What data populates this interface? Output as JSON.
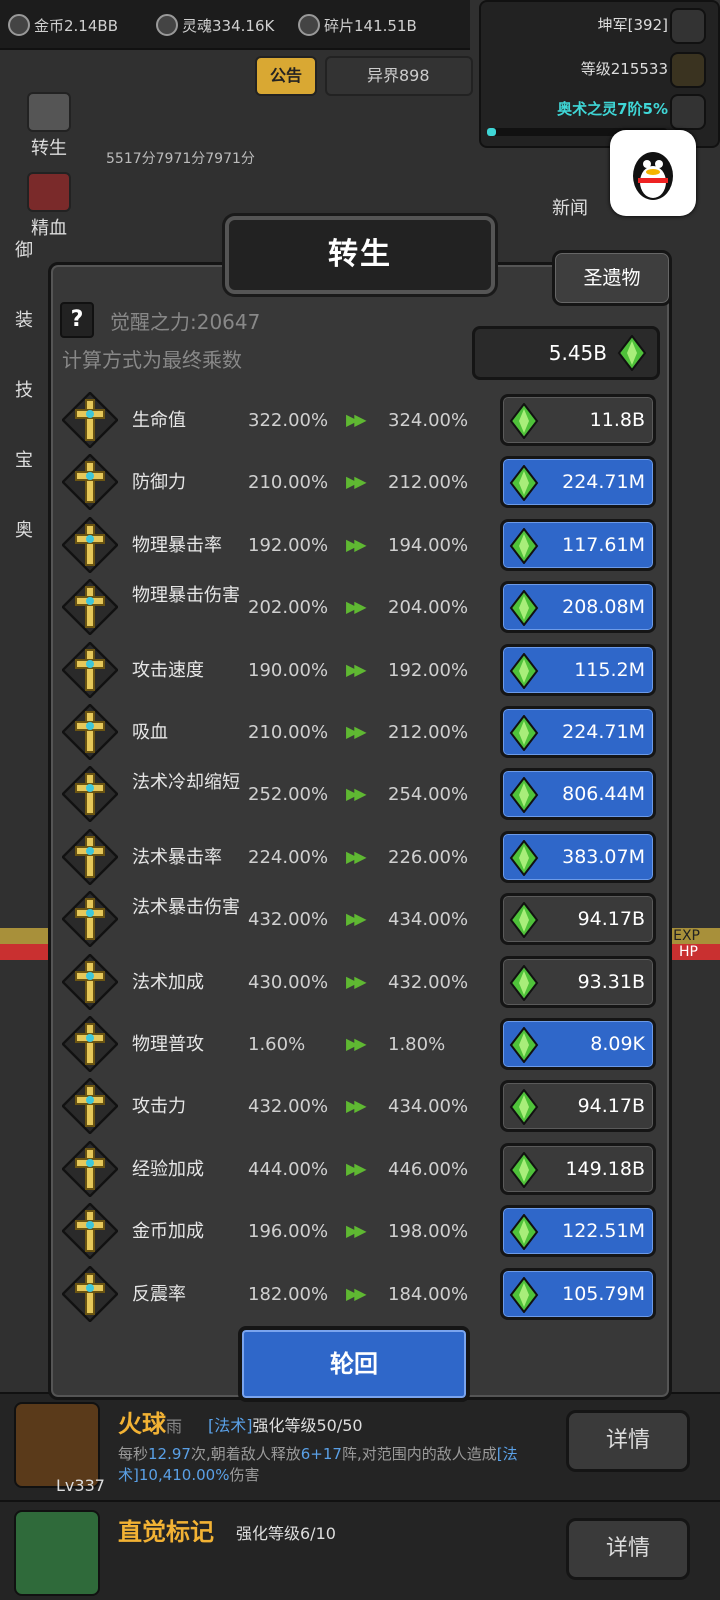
{
  "topbar": {
    "gold": "金币2.14BB",
    "soul": "灵魂334.16K",
    "shard": "碎片141.51B"
  },
  "right_panel": {
    "rank": "坤军[392]",
    "level": "等级215533",
    "arcane": "奥术之灵7阶5%",
    "arcane_progress": 0.05
  },
  "top_buttons": {
    "notice": "公告",
    "otherworld": "异界898"
  },
  "side_menu": [
    "转生",
    "精血",
    "御",
    "装",
    "技",
    "宝",
    "奥"
  ],
  "new_news": "新闻",
  "damage_text": "5517分7971分7971分",
  "modal": {
    "title": "转生",
    "relic_button": "圣遗物",
    "help_label": "?",
    "awaken_power": "觉醒之力:20647",
    "calc_note": "计算方式为最终乘数",
    "total_cost": "5.45B"
  },
  "attributes": [
    {
      "name": "生命值",
      "current": "322.00%",
      "next": "324.00%",
      "cost": "11.8B",
      "affordable": false
    },
    {
      "name": "防御力",
      "current": "210.00%",
      "next": "212.00%",
      "cost": "224.71M",
      "affordable": true
    },
    {
      "name": "物理暴击率",
      "current": "192.00%",
      "next": "194.00%",
      "cost": "117.61M",
      "affordable": true
    },
    {
      "name": "物理暴击伤害",
      "current": "202.00%",
      "next": "204.00%",
      "cost": "208.08M",
      "affordable": true
    },
    {
      "name": "攻击速度",
      "current": "190.00%",
      "next": "192.00%",
      "cost": "115.2M",
      "affordable": true
    },
    {
      "name": "吸血",
      "current": "210.00%",
      "next": "212.00%",
      "cost": "224.71M",
      "affordable": true
    },
    {
      "name": "法术冷却缩短",
      "current": "252.00%",
      "next": "254.00%",
      "cost": "806.44M",
      "affordable": true
    },
    {
      "name": "法术暴击率",
      "current": "224.00%",
      "next": "226.00%",
      "cost": "383.07M",
      "affordable": true
    },
    {
      "name": "法术暴击伤害",
      "current": "432.00%",
      "next": "434.00%",
      "cost": "94.17B",
      "affordable": false
    },
    {
      "name": "法术加成",
      "current": "430.00%",
      "next": "432.00%",
      "cost": "93.31B",
      "affordable": false
    },
    {
      "name": "物理普攻",
      "current": "1.60%",
      "next": "1.80%",
      "cost": "8.09K",
      "affordable": true
    },
    {
      "name": "攻击力",
      "current": "432.00%",
      "next": "434.00%",
      "cost": "94.17B",
      "affordable": false
    },
    {
      "name": "经验加成",
      "current": "444.00%",
      "next": "446.00%",
      "cost": "149.18B",
      "affordable": false
    },
    {
      "name": "金币加成",
      "current": "196.00%",
      "next": "198.00%",
      "cost": "122.51M",
      "affordable": true
    },
    {
      "name": "反震率",
      "current": "182.00%",
      "next": "184.00%",
      "cost": "105.79M",
      "affordable": true
    }
  ],
  "reincarnate_button": "轮回",
  "skills": [
    {
      "name": "火球",
      "name_suffix": "雨",
      "type_tag": "[法术]",
      "level_text": "强化等级50/50",
      "desc_1": "每秒",
      "desc_hl1": "12.97",
      "desc_2": "次,朝着敌人释放",
      "desc_hl2": "6+17",
      "desc_3": "阵,对范围内的敌人造成",
      "desc_hl3": "[法术]10,410.00%",
      "desc_4": "伤害",
      "level_tag": "Lv337",
      "detail": "详情"
    },
    {
      "name": "直觉标记",
      "level_text": "强化等级6/10",
      "detail": "详情"
    }
  ],
  "bars": {
    "exp": "EXP",
    "hp": "HP"
  },
  "colors": {
    "blue_button": "#2f67c9",
    "gray_button": "#3a3a3a",
    "gold": "#f2b234",
    "arrow_green": "#5fb832"
  }
}
